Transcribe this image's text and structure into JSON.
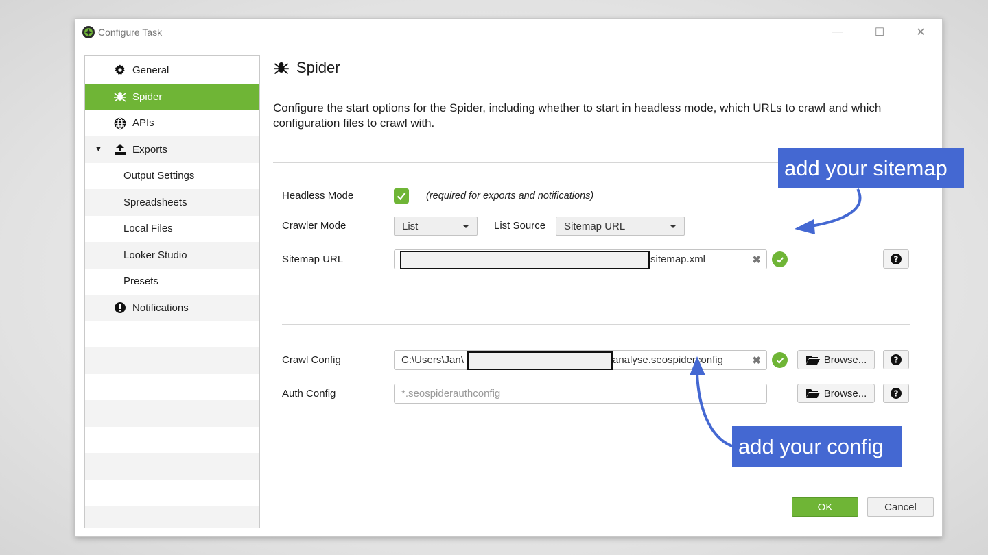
{
  "window": {
    "title": "Configure Task",
    "controls": {
      "minimize": "—",
      "maximize": "☐",
      "close": "✕"
    }
  },
  "sidebar": {
    "items": [
      {
        "label": "General",
        "icon": "gear-icon"
      },
      {
        "label": "Spider",
        "icon": "spider-icon",
        "selected": true
      },
      {
        "label": "APIs",
        "icon": "globe-icon"
      },
      {
        "label": "Exports",
        "icon": "upload-icon",
        "expanded": true
      },
      {
        "label": "Output Settings"
      },
      {
        "label": "Spreadsheets"
      },
      {
        "label": "Local Files"
      },
      {
        "label": "Looker Studio"
      },
      {
        "label": "Presets"
      },
      {
        "label": "Notifications",
        "icon": "alert-icon"
      }
    ]
  },
  "main": {
    "title": "Spider",
    "description": "Configure the start options for the Spider, including whether to start in headless mode, which URLs to crawl and which configuration files to crawl with.",
    "headless": {
      "label": "Headless Mode",
      "checked": true,
      "note": "(required for exports and notifications)"
    },
    "crawler_mode": {
      "label": "Crawler Mode",
      "value": "List"
    },
    "list_source": {
      "label": "List Source",
      "value": "Sitemap URL"
    },
    "sitemap": {
      "label": "Sitemap URL",
      "value_suffix": "sitemap.xml",
      "clear": "✖"
    },
    "crawl_config": {
      "label": "Crawl Config",
      "value_prefix": "C:\\Users\\Jan\\",
      "value_suffix": "analyse.seospiderconfig",
      "clear": "✖",
      "browse": "Browse..."
    },
    "auth_config": {
      "label": "Auth Config",
      "placeholder": "*.seospiderauthconfig",
      "browse": "Browse..."
    },
    "help": "?"
  },
  "footer": {
    "ok": "OK",
    "cancel": "Cancel"
  },
  "annotations": {
    "sitemap_callout": "add your sitemap",
    "config_callout": "add your config"
  },
  "colors": {
    "accent": "#6fb536",
    "callout": "#4468d2"
  }
}
